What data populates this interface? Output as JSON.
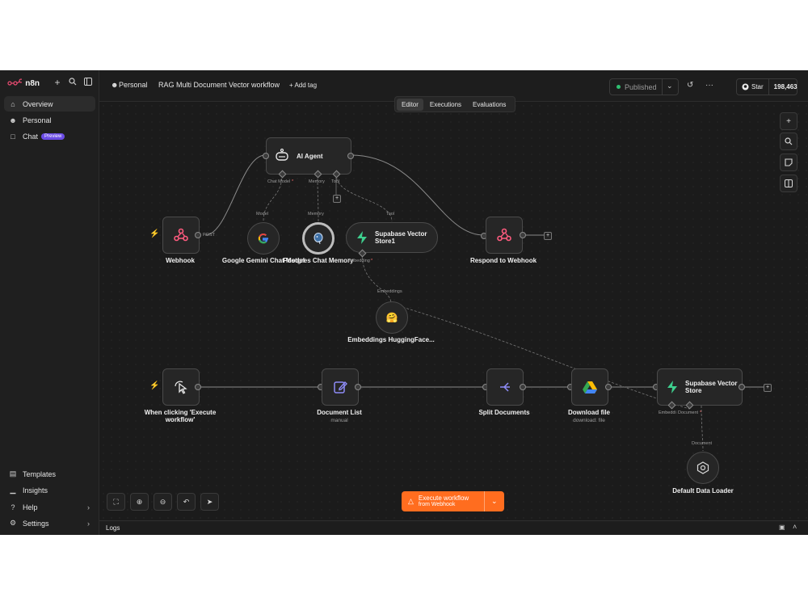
{
  "app": {
    "brand": "n8n"
  },
  "sidebar": {
    "items": [
      {
        "label": "Overview",
        "icon": "home-icon"
      },
      {
        "label": "Personal",
        "icon": "user-icon"
      },
      {
        "label": "Chat",
        "icon": "chat-icon",
        "badge": "Preview"
      }
    ],
    "bottom": [
      {
        "label": "Templates",
        "icon": "templates-icon"
      },
      {
        "label": "Insights",
        "icon": "insights-icon"
      },
      {
        "label": "Help",
        "icon": "help-icon"
      },
      {
        "label": "Settings",
        "icon": "settings-icon"
      }
    ]
  },
  "header": {
    "project": "Personal",
    "workflow_name": "RAG Multi Document Vector workflow",
    "add_tag": "+ Add tag",
    "status": "Published",
    "github_star": "Star",
    "github_count": "198,463"
  },
  "tabs": [
    "Editor",
    "Executions",
    "Evaluations"
  ],
  "nodes": {
    "ai_agent": "AI Agent",
    "webhook": "Webhook",
    "webhook_port": "POST",
    "gemini": "Google Gemini Chat Model",
    "postgres": "Postgres Chat Memory",
    "supabase1": "Supabase Vector Store1",
    "respond": "Respond to Webhook",
    "embeddings": "Embeddings HuggingFace...",
    "manual_trigger": "When clicking 'Execute workflow'",
    "document_list": "Document List",
    "document_list_sub": "manual",
    "split": "Split Documents",
    "download": "Download file",
    "download_sub": "download: file",
    "supabase": "Supabase Vector Store",
    "loader": "Default Data Loader"
  },
  "ports": {
    "chat_model": "Chat Model",
    "memory": "Memory",
    "tool": "Tool",
    "model": "Model",
    "memory2": "Memory",
    "tool2": "Tool",
    "embedding": "Embedding",
    "embeddings": "Embeddings",
    "embedding_short": "Embeddi",
    "document": "Document",
    "document2": "Document"
  },
  "execute": {
    "line1": "Execute workflow",
    "line2": "from Webhook"
  },
  "logs": {
    "label": "Logs"
  }
}
